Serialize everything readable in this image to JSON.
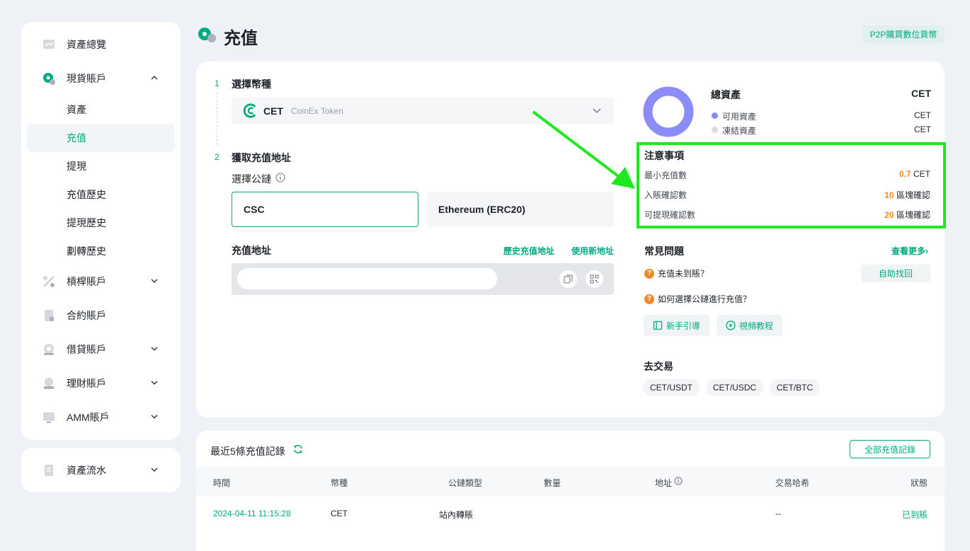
{
  "page": {
    "title": "充值",
    "p2p_button": "P2P購買數位貨幣"
  },
  "sidebar": {
    "overview": "資產總覽",
    "spot": "現貨賬戶",
    "spot_sub": [
      "資產",
      "充值",
      "提現",
      "充值歷史",
      "提現歷史",
      "劃轉歷史"
    ],
    "margin": "槓桿賬戶",
    "futures": "合約賬戶",
    "loan": "借貸賬戶",
    "finance": "理財賬戶",
    "amm": "AMM賬戶",
    "flow": "資產流水"
  },
  "deposit": {
    "step1": "1",
    "step1_title": "選擇幣種",
    "coin_symbol": "CET",
    "coin_name": "CoinEx Token",
    "step2": "2",
    "step2_title": "獲取充值地址",
    "chain_label": "選擇公鏈",
    "chains": [
      "CSC",
      "Ethereum (ERC20)"
    ],
    "address_label": "充值地址",
    "history_address_link": "歷史充值地址",
    "new_address_link": "使用新地址"
  },
  "assets": {
    "title": "總資產",
    "unit": "CET",
    "available_label": "可用資產",
    "available_unit": "CET",
    "frozen_label": "凍結資產",
    "frozen_unit": "CET",
    "available_color": "#8b8cf8",
    "frozen_color": "#d9dbe0"
  },
  "notice": {
    "title": "注意事項",
    "min_label": "最小充值數",
    "min_value": "0.7",
    "min_unit": "CET",
    "confirm_label": "入賬確認數",
    "confirm_value": "10",
    "confirm_unit": "區塊確認",
    "withdraw_label": "可提現確認數",
    "withdraw_value": "20",
    "withdraw_unit": "區塊確認"
  },
  "faq": {
    "title": "常見問題",
    "more": "查看更多",
    "q1": "充值未到賬？",
    "self_help": "自助找回",
    "q2": "如何選擇公鏈進行充值？",
    "guide": "新手引導",
    "video": "視頻教程"
  },
  "trade": {
    "title": "去交易",
    "pairs": [
      "CET/USDT",
      "CET/USDC",
      "CET/BTC"
    ]
  },
  "records": {
    "title": "最近5條充值記錄",
    "all_button": "全部充值記錄",
    "headers": [
      "時間",
      "幣種",
      "公鏈類型",
      "數量",
      "地址",
      "交易哈希",
      "狀態"
    ],
    "rows": [
      {
        "time": "2024-04-11 11:15:28",
        "coin": "CET",
        "chain": "站內轉賬",
        "amount": "",
        "address": "",
        "hash": "--",
        "status": "已到賬"
      }
    ]
  }
}
